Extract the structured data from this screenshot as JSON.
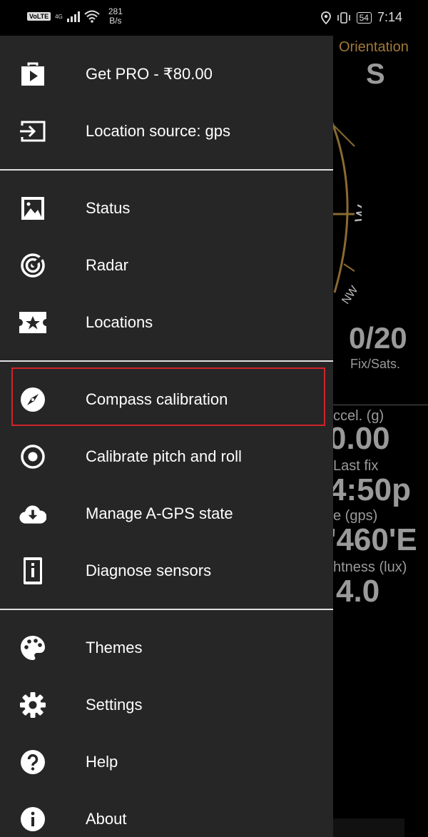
{
  "status_bar": {
    "volte": "VoLTE",
    "network": "4G",
    "speed_value": "281",
    "speed_unit": "B/s",
    "battery": "54",
    "time": "7:14"
  },
  "background_app": {
    "orientation_label": "Orientation",
    "orientation_value": "S",
    "compass_w": "W",
    "compass_nw": "NW",
    "fix_value": "0/20",
    "fix_label": "Fix/Sats.",
    "accel_label": "ccel. (g)",
    "accel_value": "0.00",
    "last_fix_label": "Last fix",
    "last_fix_value": "4:50p",
    "gps_label": "e (gps)",
    "gps_value": "'460'E",
    "lux_label": "htness (lux)",
    "lux_value": "4.0"
  },
  "drawer": {
    "items": [
      {
        "label": "Get PRO - ₹80.00",
        "icon": "play-store-bag-icon"
      },
      {
        "label": "Location source: gps",
        "icon": "input-icon"
      },
      {
        "label": "Status",
        "icon": "image-icon"
      },
      {
        "label": "Radar",
        "icon": "radar-icon"
      },
      {
        "label": "Locations",
        "icon": "star-ticket-icon"
      },
      {
        "label": "Compass calibration",
        "icon": "compass-icon"
      },
      {
        "label": "Calibrate pitch and roll",
        "icon": "target-icon"
      },
      {
        "label": "Manage A-GPS state",
        "icon": "cloud-download-icon"
      },
      {
        "label": "Diagnose sensors",
        "icon": "device-info-icon"
      },
      {
        "label": "Themes",
        "icon": "palette-icon"
      },
      {
        "label": "Settings",
        "icon": "gear-icon"
      },
      {
        "label": "Help",
        "icon": "help-icon"
      },
      {
        "label": "About",
        "icon": "info-icon"
      }
    ],
    "highlighted_item": "Compass calibration"
  },
  "colors": {
    "drawer_bg": "#262626",
    "highlight_border": "#d2232a",
    "compass_accent": "#a07a3a"
  }
}
